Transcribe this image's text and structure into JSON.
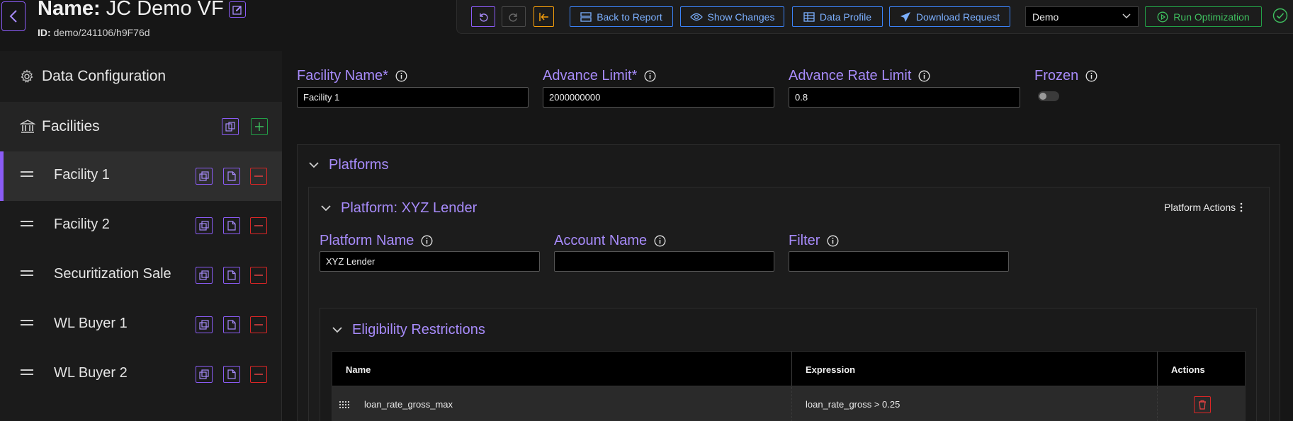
{
  "header": {
    "name_label": "Name:",
    "name_value": "JC Demo VF",
    "id_label": "ID:",
    "id_value": "demo/241106/h9F76d"
  },
  "toolbar": {
    "back_to_report": "Back to Report",
    "show_changes": "Show Changes",
    "data_profile": "Data Profile",
    "download_request": "Download Request",
    "environment_select": "Demo",
    "run_optimization": "Run Optimization"
  },
  "sidebar": {
    "data_configuration": "Data Configuration",
    "facilities": "Facilities",
    "items": [
      {
        "label": "Facility 1",
        "active": true
      },
      {
        "label": "Facility 2",
        "active": false
      },
      {
        "label": "Securitization Sale",
        "active": false
      },
      {
        "label": "WL Buyer 1",
        "active": false
      },
      {
        "label": "WL Buyer 2",
        "active": false
      }
    ]
  },
  "facility_form": {
    "facility_name_label": "Facility Name*",
    "facility_name_value": "Facility 1",
    "advance_limit_label": "Advance Limit*",
    "advance_limit_value": "2000000000",
    "advance_rate_limit_label": "Advance Rate Limit",
    "advance_rate_limit_value": "0.8",
    "frozen_label": "Frozen",
    "frozen_on": false
  },
  "platforms": {
    "title": "Platforms",
    "platform_title": "Platform: XYZ Lender",
    "platform_actions": "Platform Actions",
    "platform_name_label": "Platform Name",
    "platform_name_value": "XYZ Lender",
    "account_name_label": "Account Name",
    "account_name_value": "",
    "filter_label": "Filter",
    "filter_value": ""
  },
  "eligibility": {
    "title": "Eligibility Restrictions",
    "columns": [
      "Name",
      "Expression",
      "Actions"
    ],
    "rows": [
      {
        "name": "loan_rate_gross_max",
        "expression": "loan_rate_gross > 0.25"
      }
    ]
  },
  "colors": {
    "accent_purple": "#a78bfa",
    "accent_green": "#3fbf5f",
    "accent_blue": "#3b82f6",
    "accent_orange": "#f59e0b",
    "danger_red": "#ef4444"
  }
}
